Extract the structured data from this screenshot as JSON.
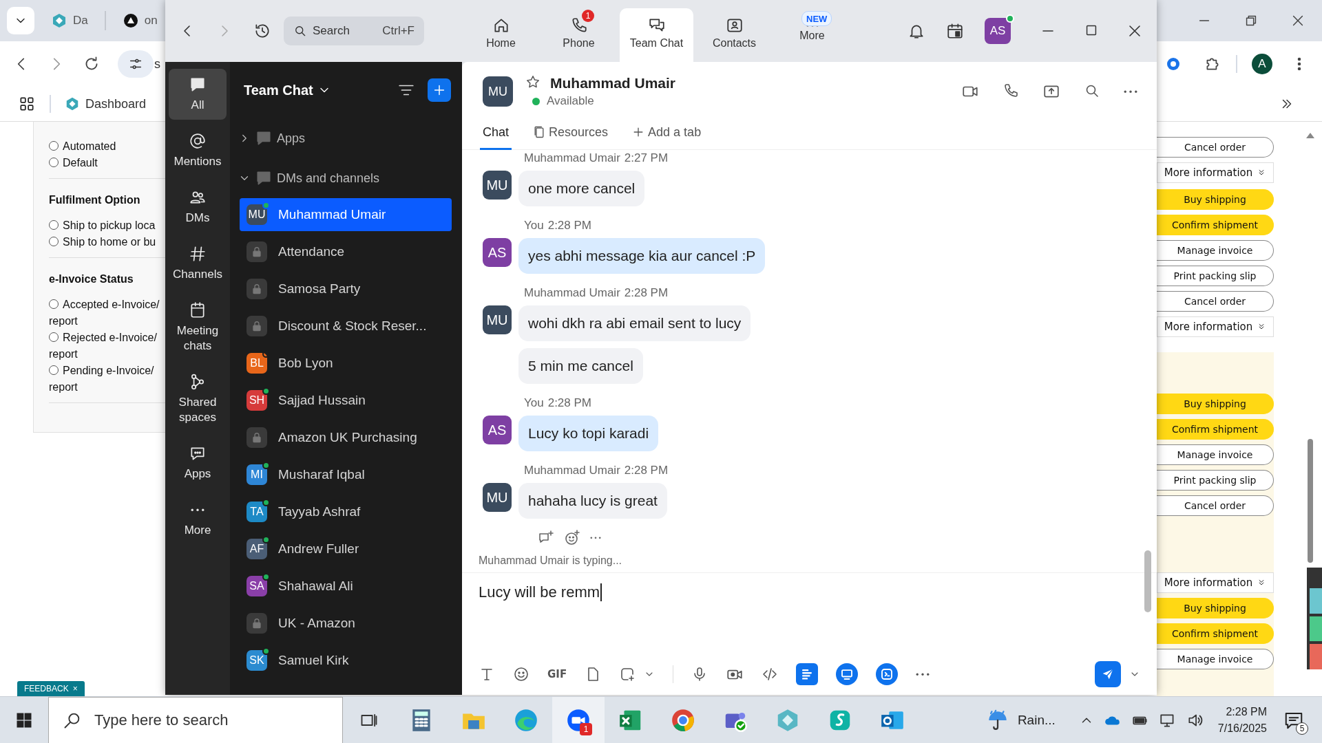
{
  "browser": {
    "tabs": [
      {
        "label": "Da"
      },
      {
        "label": "on"
      }
    ],
    "address_text": "s",
    "profile_initial": "A",
    "bookmarks": [
      {
        "label": "Dashboard"
      }
    ]
  },
  "order_form": {
    "sections": [
      {
        "options": [
          {
            "lines": [
              "Automated"
            ],
            "checked": false
          },
          {
            "lines": [
              "Default"
            ],
            "checked": false
          }
        ]
      },
      {
        "title": "Fulfilment Option",
        "options": [
          {
            "lines": [
              "Ship to pickup loca"
            ],
            "checked": false
          },
          {
            "lines": [
              "Ship to home or bu"
            ],
            "checked": false
          }
        ]
      },
      {
        "title": "e-Invoice Status",
        "options": [
          {
            "lines": [
              "Accepted e-Invoice/",
              "report"
            ],
            "checked": false
          },
          {
            "lines": [
              "Rejected e-Invoice/",
              "report"
            ],
            "checked": false
          },
          {
            "lines": [
              "Pending e-Invoice/",
              "report"
            ],
            "checked": false
          }
        ]
      }
    ]
  },
  "order_actions": {
    "groups": [
      [
        {
          "kind": "secondary",
          "label": "Cancel order"
        },
        {
          "kind": "more",
          "label": "More information"
        }
      ],
      [
        {
          "kind": "primary",
          "label": "Buy shipping"
        },
        {
          "kind": "primary",
          "label": "Confirm shipment"
        },
        {
          "kind": "secondary",
          "label": "Manage invoice"
        },
        {
          "kind": "secondary",
          "label": "Print packing slip"
        },
        {
          "kind": "secondary",
          "label": "Cancel order"
        },
        {
          "kind": "more",
          "label": "More information"
        }
      ],
      [
        {
          "kind": "primary",
          "label": "Buy shipping"
        },
        {
          "kind": "primary",
          "label": "Confirm shipment"
        },
        {
          "kind": "secondary",
          "label": "Manage invoice"
        },
        {
          "kind": "secondary",
          "label": "Print packing slip"
        },
        {
          "kind": "secondary",
          "label": "Cancel order"
        }
      ],
      [
        {
          "kind": "more",
          "label": "More information"
        },
        {
          "kind": "primary",
          "label": "Buy shipping"
        },
        {
          "kind": "primary",
          "label": "Confirm shipment"
        },
        {
          "kind": "secondary",
          "label": "Manage invoice"
        }
      ]
    ]
  },
  "feedback": {
    "label": "FEEDBACK",
    "close": "×"
  },
  "zoom": {
    "search": {
      "placeholder": "Search",
      "shortcut": "Ctrl+F"
    },
    "tabs": [
      {
        "label": "Home",
        "selected": false
      },
      {
        "label": "Phone",
        "selected": false,
        "badge": {
          "kind": "count",
          "text": "1"
        }
      },
      {
        "label": "Team Chat",
        "selected": true
      },
      {
        "label": "Contacts",
        "selected": false
      },
      {
        "label": "More",
        "selected": false,
        "badge": {
          "kind": "new",
          "text": "NEW"
        }
      }
    ],
    "user": {
      "initials": "AS",
      "online": true
    },
    "rail": [
      {
        "label": "All",
        "selected": true
      },
      {
        "label": "Mentions",
        "selected": false
      },
      {
        "label": "DMs",
        "selected": false
      },
      {
        "label": "Channels",
        "selected": false
      },
      {
        "label": "Meeting chats",
        "selected": false
      },
      {
        "label": "Shared spaces",
        "selected": false
      },
      {
        "label": "Apps",
        "selected": false
      },
      {
        "label": "More",
        "selected": false
      }
    ],
    "list_title": "Team Chat",
    "sections": [
      {
        "label": "Apps",
        "expanded": false
      },
      {
        "label": "DMs and channels",
        "expanded": true
      }
    ],
    "conversations": [
      {
        "kind": "dm",
        "initials": "MU",
        "color": "#3b4b5e",
        "name": "Muhammad Umair",
        "online": true,
        "selected": true
      },
      {
        "kind": "channel",
        "name": "Attendance",
        "selected": false
      },
      {
        "kind": "channel",
        "name": "Samosa Party",
        "selected": false
      },
      {
        "kind": "channel",
        "name": "Discount & Stock Reser...",
        "selected": false
      },
      {
        "kind": "dm",
        "initials": "BL",
        "color": "#e8661a",
        "name": "Bob Lyon",
        "online": false,
        "selected": false
      },
      {
        "kind": "dm",
        "initials": "SH",
        "color": "#d63b3b",
        "name": "Sajjad Hussain",
        "online": true,
        "selected": false
      },
      {
        "kind": "channel",
        "name": "Amazon UK Purchasing",
        "selected": false
      },
      {
        "kind": "dm",
        "initials": "MI",
        "color": "#2e86d6",
        "name": "Musharaf Iqbal",
        "online": true,
        "selected": false
      },
      {
        "kind": "dm",
        "initials": "TA",
        "color": "#1d8ac6",
        "name": "Tayyab Ashraf",
        "online": true,
        "selected": false
      },
      {
        "kind": "dm",
        "initials": "AF",
        "color": "#4b5e76",
        "name": "Andrew Fuller",
        "online": true,
        "selected": false
      },
      {
        "kind": "dm",
        "initials": "SA",
        "color": "#8a3fa8",
        "name": "Shahawal Ali",
        "online": true,
        "selected": false
      },
      {
        "kind": "channel",
        "name": "UK - Amazon",
        "selected": false
      },
      {
        "kind": "dm",
        "initials": "SK",
        "color": "#2b8bd0",
        "name": "Samuel Kirk",
        "online": true,
        "selected": false
      }
    ],
    "chat": {
      "initials": "MU",
      "name": "Muhammad Umair",
      "status": "Available",
      "tabs": [
        {
          "label": "Chat",
          "selected": true
        },
        {
          "label": "Resources",
          "selected": false
        },
        {
          "label": "Add a tab",
          "selected": false
        }
      ],
      "messages": [
        {
          "initials": "MU",
          "color": "#3b4b5e",
          "sender": "Muhammad Umair",
          "time": "2:27 PM",
          "mine": false,
          "bubbles": [
            "one more cancel"
          ]
        },
        {
          "initials": "AS",
          "color": "#7e3fa3",
          "sender": "You",
          "time": "2:28 PM",
          "mine": true,
          "bubbles": [
            "yes abhi message kia aur cancel :P"
          ]
        },
        {
          "initials": "MU",
          "color": "#3b4b5e",
          "sender": "Muhammad Umair",
          "time": "2:28 PM",
          "mine": false,
          "bubbles": [
            "wohi dkh ra abi email sent to lucy",
            "5 min me cancel"
          ]
        },
        {
          "initials": "AS",
          "color": "#7e3fa3",
          "sender": "You",
          "time": "2:28 PM",
          "mine": true,
          "bubbles": [
            "Lucy ko topi karadi"
          ]
        },
        {
          "initials": "MU",
          "color": "#3b4b5e",
          "sender": "Muhammad Umair",
          "time": "2:28 PM",
          "mine": false,
          "bubbles": [
            "hahaha lucy is great"
          ]
        }
      ],
      "typing": "Muhammad Umair  is typing...",
      "draft": "Lucy will be remm",
      "gif_label": "GIF"
    }
  },
  "taskbar": {
    "search_placeholder": "Type here to search",
    "zoom_badge": "1",
    "weather": "Rain...",
    "time": "2:28 PM",
    "date": "7/16/2025",
    "notifications": "5"
  }
}
